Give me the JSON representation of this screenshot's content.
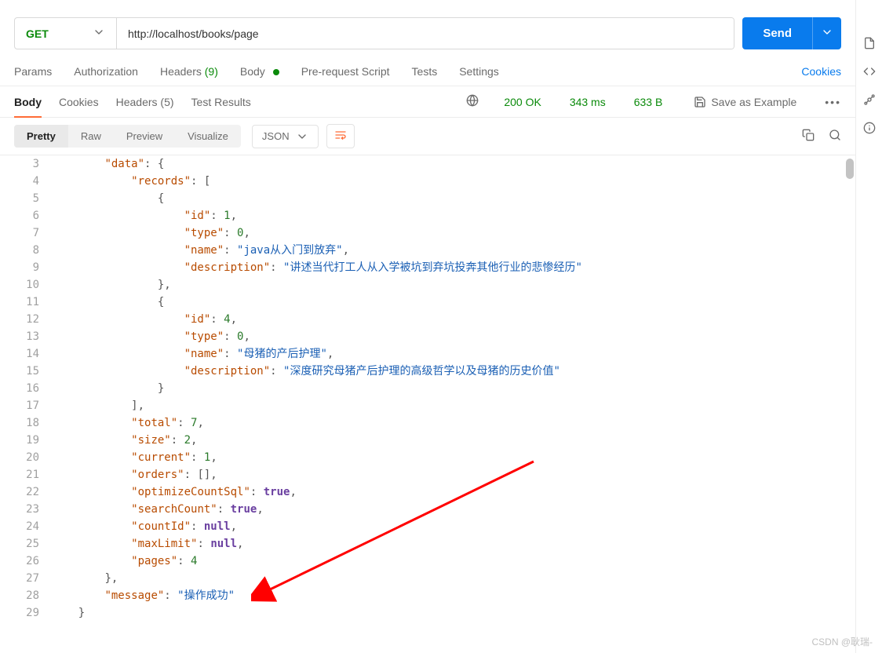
{
  "request": {
    "method": "GET",
    "url": "http://localhost/books/page",
    "send_label": "Send"
  },
  "req_tabs": {
    "params": "Params",
    "auth": "Authorization",
    "headers_label": "Headers",
    "headers_count": "(9)",
    "body": "Body",
    "prescript": "Pre-request Script",
    "tests": "Tests",
    "settings": "Settings",
    "cookies": "Cookies"
  },
  "resp_tabs": {
    "body": "Body",
    "cookies": "Cookies",
    "headers_label": "Headers",
    "headers_count": "(5)",
    "tests": "Test Results",
    "status_text": "200 OK",
    "time": "343 ms",
    "size": "633 B",
    "save": "Save as Example"
  },
  "view": {
    "pretty": "Pretty",
    "raw": "Raw",
    "preview": "Preview",
    "visualize": "Visualize",
    "format": "JSON"
  },
  "code_lines": [
    {
      "n": 3,
      "indent": 2,
      "tokens": [
        {
          "t": "key",
          "v": "\"data\""
        },
        {
          "t": "pun",
          "v": ": {"
        }
      ]
    },
    {
      "n": 4,
      "indent": 3,
      "tokens": [
        {
          "t": "key",
          "v": "\"records\""
        },
        {
          "t": "pun",
          "v": ": ["
        }
      ]
    },
    {
      "n": 5,
      "indent": 4,
      "tokens": [
        {
          "t": "pun",
          "v": "{"
        }
      ]
    },
    {
      "n": 6,
      "indent": 5,
      "tokens": [
        {
          "t": "key",
          "v": "\"id\""
        },
        {
          "t": "pun",
          "v": ": "
        },
        {
          "t": "num",
          "v": "1"
        },
        {
          "t": "pun",
          "v": ","
        }
      ]
    },
    {
      "n": 7,
      "indent": 5,
      "tokens": [
        {
          "t": "key",
          "v": "\"type\""
        },
        {
          "t": "pun",
          "v": ": "
        },
        {
          "t": "num",
          "v": "0"
        },
        {
          "t": "pun",
          "v": ","
        }
      ]
    },
    {
      "n": 8,
      "indent": 5,
      "tokens": [
        {
          "t": "key",
          "v": "\"name\""
        },
        {
          "t": "pun",
          "v": ": "
        },
        {
          "t": "str",
          "v": "\"java从入门到放弃\""
        },
        {
          "t": "pun",
          "v": ","
        }
      ]
    },
    {
      "n": 9,
      "indent": 5,
      "tokens": [
        {
          "t": "key",
          "v": "\"description\""
        },
        {
          "t": "pun",
          "v": ": "
        },
        {
          "t": "str",
          "v": "\"讲述当代打工人从入学被坑到弃坑投奔其他行业的悲惨经历\""
        }
      ]
    },
    {
      "n": 10,
      "indent": 4,
      "tokens": [
        {
          "t": "pun",
          "v": "},"
        }
      ]
    },
    {
      "n": 11,
      "indent": 4,
      "tokens": [
        {
          "t": "pun",
          "v": "{"
        }
      ]
    },
    {
      "n": 12,
      "indent": 5,
      "tokens": [
        {
          "t": "key",
          "v": "\"id\""
        },
        {
          "t": "pun",
          "v": ": "
        },
        {
          "t": "num",
          "v": "4"
        },
        {
          "t": "pun",
          "v": ","
        }
      ]
    },
    {
      "n": 13,
      "indent": 5,
      "tokens": [
        {
          "t": "key",
          "v": "\"type\""
        },
        {
          "t": "pun",
          "v": ": "
        },
        {
          "t": "num",
          "v": "0"
        },
        {
          "t": "pun",
          "v": ","
        }
      ]
    },
    {
      "n": 14,
      "indent": 5,
      "tokens": [
        {
          "t": "key",
          "v": "\"name\""
        },
        {
          "t": "pun",
          "v": ": "
        },
        {
          "t": "str",
          "v": "\"母猪的产后护理\""
        },
        {
          "t": "pun",
          "v": ","
        }
      ]
    },
    {
      "n": 15,
      "indent": 5,
      "tokens": [
        {
          "t": "key",
          "v": "\"description\""
        },
        {
          "t": "pun",
          "v": ": "
        },
        {
          "t": "str",
          "v": "\"深度研究母猪产后护理的高级哲学以及母猪的历史价值\""
        }
      ]
    },
    {
      "n": 16,
      "indent": 4,
      "tokens": [
        {
          "t": "pun",
          "v": "}"
        }
      ]
    },
    {
      "n": 17,
      "indent": 3,
      "tokens": [
        {
          "t": "pun",
          "v": "],"
        }
      ]
    },
    {
      "n": 18,
      "indent": 3,
      "tokens": [
        {
          "t": "key",
          "v": "\"total\""
        },
        {
          "t": "pun",
          "v": ": "
        },
        {
          "t": "num",
          "v": "7"
        },
        {
          "t": "pun",
          "v": ","
        }
      ]
    },
    {
      "n": 19,
      "indent": 3,
      "tokens": [
        {
          "t": "key",
          "v": "\"size\""
        },
        {
          "t": "pun",
          "v": ": "
        },
        {
          "t": "num",
          "v": "2"
        },
        {
          "t": "pun",
          "v": ","
        }
      ]
    },
    {
      "n": 20,
      "indent": 3,
      "tokens": [
        {
          "t": "key",
          "v": "\"current\""
        },
        {
          "t": "pun",
          "v": ": "
        },
        {
          "t": "num",
          "v": "1"
        },
        {
          "t": "pun",
          "v": ","
        }
      ]
    },
    {
      "n": 21,
      "indent": 3,
      "tokens": [
        {
          "t": "key",
          "v": "\"orders\""
        },
        {
          "t": "pun",
          "v": ": [],"
        }
      ]
    },
    {
      "n": 22,
      "indent": 3,
      "tokens": [
        {
          "t": "key",
          "v": "\"optimizeCountSql\""
        },
        {
          "t": "pun",
          "v": ": "
        },
        {
          "t": "kw",
          "v": "true"
        },
        {
          "t": "pun",
          "v": ","
        }
      ]
    },
    {
      "n": 23,
      "indent": 3,
      "tokens": [
        {
          "t": "key",
          "v": "\"searchCount\""
        },
        {
          "t": "pun",
          "v": ": "
        },
        {
          "t": "kw",
          "v": "true"
        },
        {
          "t": "pun",
          "v": ","
        }
      ]
    },
    {
      "n": 24,
      "indent": 3,
      "tokens": [
        {
          "t": "key",
          "v": "\"countId\""
        },
        {
          "t": "pun",
          "v": ": "
        },
        {
          "t": "kw",
          "v": "null"
        },
        {
          "t": "pun",
          "v": ","
        }
      ]
    },
    {
      "n": 25,
      "indent": 3,
      "tokens": [
        {
          "t": "key",
          "v": "\"maxLimit\""
        },
        {
          "t": "pun",
          "v": ": "
        },
        {
          "t": "kw",
          "v": "null"
        },
        {
          "t": "pun",
          "v": ","
        }
      ]
    },
    {
      "n": 26,
      "indent": 3,
      "tokens": [
        {
          "t": "key",
          "v": "\"pages\""
        },
        {
          "t": "pun",
          "v": ": "
        },
        {
          "t": "num",
          "v": "4"
        }
      ]
    },
    {
      "n": 27,
      "indent": 2,
      "tokens": [
        {
          "t": "pun",
          "v": "},"
        }
      ]
    },
    {
      "n": 28,
      "indent": 2,
      "tokens": [
        {
          "t": "key",
          "v": "\"message\""
        },
        {
          "t": "pun",
          "v": ": "
        },
        {
          "t": "str",
          "v": "\"操作成功\""
        }
      ]
    },
    {
      "n": 29,
      "indent": 1,
      "tokens": [
        {
          "t": "pun",
          "v": "}"
        }
      ]
    }
  ],
  "watermark": "CSDN @耿瑞-"
}
